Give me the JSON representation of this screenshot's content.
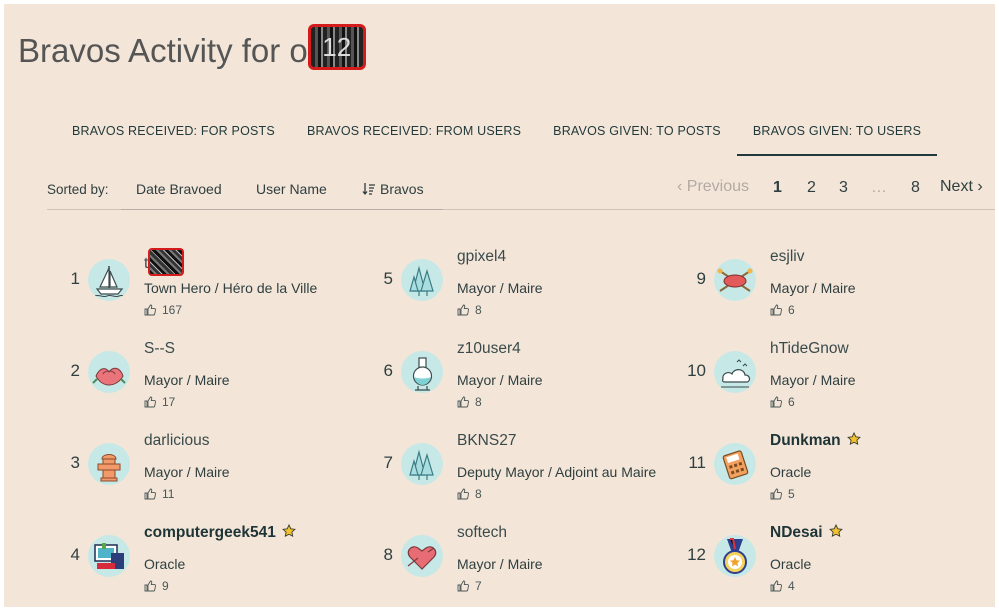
{
  "title_prefix": "Bravos Activity for o",
  "title_user": "12",
  "tabs": [
    {
      "label": "BRAVOS RECEIVED: FOR POSTS"
    },
    {
      "label": "BRAVOS RECEIVED: FROM USERS"
    },
    {
      "label": "BRAVOS GIVEN: TO POSTS"
    },
    {
      "label": "BRAVOS GIVEN: TO USERS",
      "active": true
    }
  ],
  "sort": {
    "label": "Sorted by:",
    "options": [
      "Date Bravoed",
      "User Name",
      "Bravos"
    ],
    "active": "Bravos"
  },
  "pager": {
    "prev": "Previous",
    "pages": [
      "1",
      "2",
      "3",
      "…",
      "8"
    ],
    "current": "1",
    "next": "Next"
  },
  "users": [
    {
      "rank": "1",
      "name": "t",
      "rank_title": "Town Hero / Héro de la Ville",
      "bravos": "167",
      "avatar": "sailboat-icon"
    },
    {
      "rank": "2",
      "name": "S--S",
      "rank_title": "Mayor / Maire",
      "bravos": "17",
      "avatar": "rose-icon"
    },
    {
      "rank": "3",
      "name": "darlicious",
      "rank_title": "Mayor / Maire",
      "bravos": "11",
      "avatar": "hydrant-icon"
    },
    {
      "rank": "4",
      "name": "computergeek541",
      "rank_title": "Oracle",
      "bravos": "9",
      "avatar": "computer-icon",
      "oracle": true
    },
    {
      "rank": "5",
      "name": "gpixel4",
      "rank_title": "Mayor / Maire",
      "bravos": "8",
      "avatar": "trees-icon"
    },
    {
      "rank": "6",
      "name": "z10user4",
      "rank_title": "Mayor / Maire",
      "bravos": "8",
      "avatar": "flask-icon"
    },
    {
      "rank": "7",
      "name": "BKNS27",
      "rank_title": "Deputy Mayor / Adjoint au Maire",
      "bravos": "8",
      "avatar": "trees-icon"
    },
    {
      "rank": "8",
      "name": "softech",
      "rank_title": "Mayor / Maire",
      "bravos": "7",
      "avatar": "heart-icon"
    },
    {
      "rank": "9",
      "name": "esjliv",
      "rank_title": "Mayor / Maire",
      "bravos": "6",
      "avatar": "canoe-icon"
    },
    {
      "rank": "10",
      "name": "hTideGnow",
      "rank_title": "Mayor / Maire",
      "bravos": "6",
      "avatar": "cloud-icon"
    },
    {
      "rank": "11",
      "name": "Dunkman",
      "rank_title": "Oracle",
      "bravos": "5",
      "avatar": "calculator-icon",
      "oracle": true
    },
    {
      "rank": "12",
      "name": "NDesai",
      "rank_title": "Oracle",
      "bravos": "4",
      "avatar": "medal-icon",
      "oracle": true
    }
  ],
  "colors": {
    "background": "#f3e6d9",
    "avatar_bg": "#c6e8e6",
    "text": "#2f3e3f",
    "redaction_border": "#d41c1c"
  }
}
